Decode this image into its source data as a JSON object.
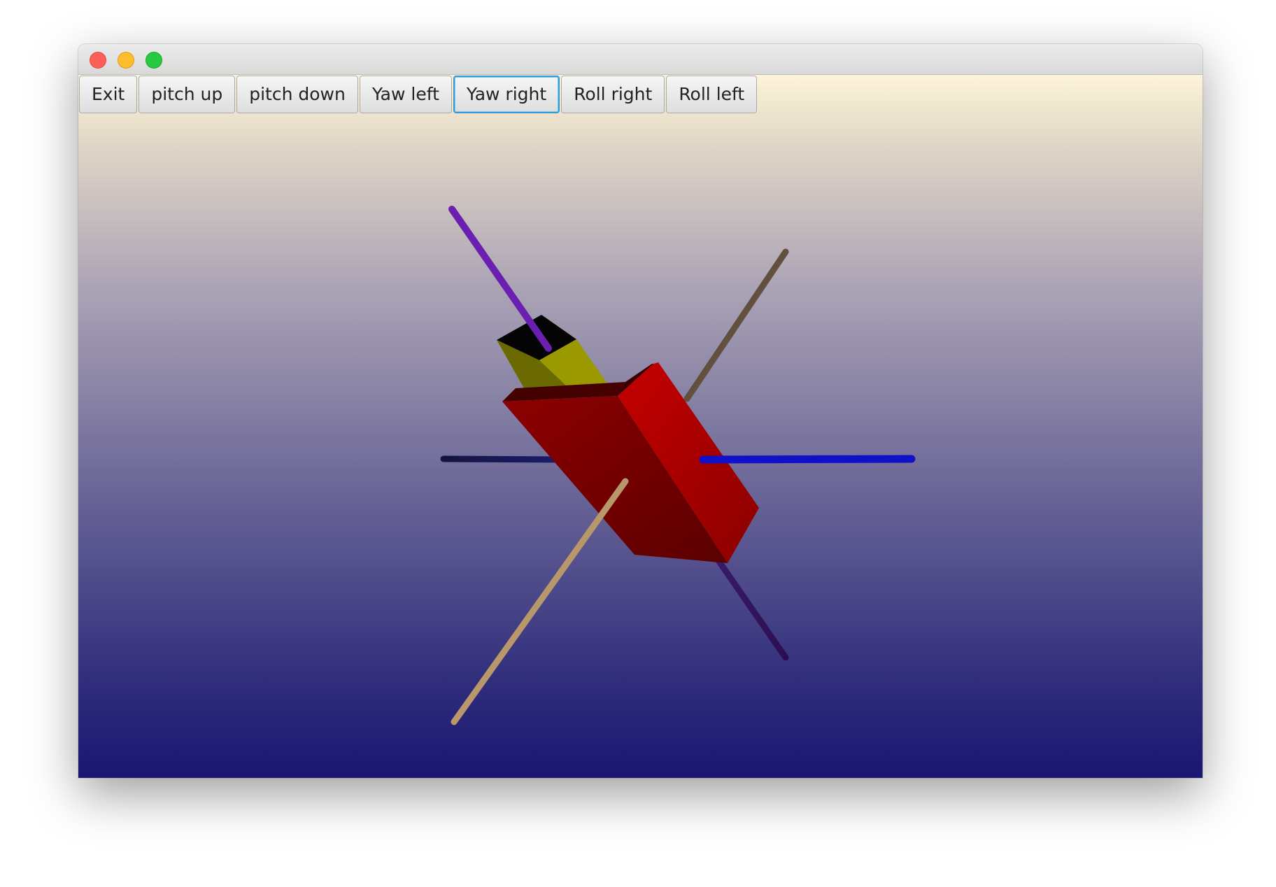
{
  "window": {
    "controls": [
      "close",
      "minimize",
      "maximize"
    ]
  },
  "toolbar": {
    "buttons": [
      {
        "label": "Exit"
      },
      {
        "label": "pitch up"
      },
      {
        "label": "pitch down"
      },
      {
        "label": "Yaw left"
      },
      {
        "label": "Yaw right",
        "focused": true
      },
      {
        "label": "Roll right"
      },
      {
        "label": "Roll left"
      }
    ]
  },
  "scene": {
    "objects": {
      "body_color": "#b00000",
      "head_color": "#9a9a00",
      "axis_colors": {
        "purple": "#6a1fb0",
        "tan": "#b8976a",
        "blue": "#1010c8"
      }
    }
  }
}
